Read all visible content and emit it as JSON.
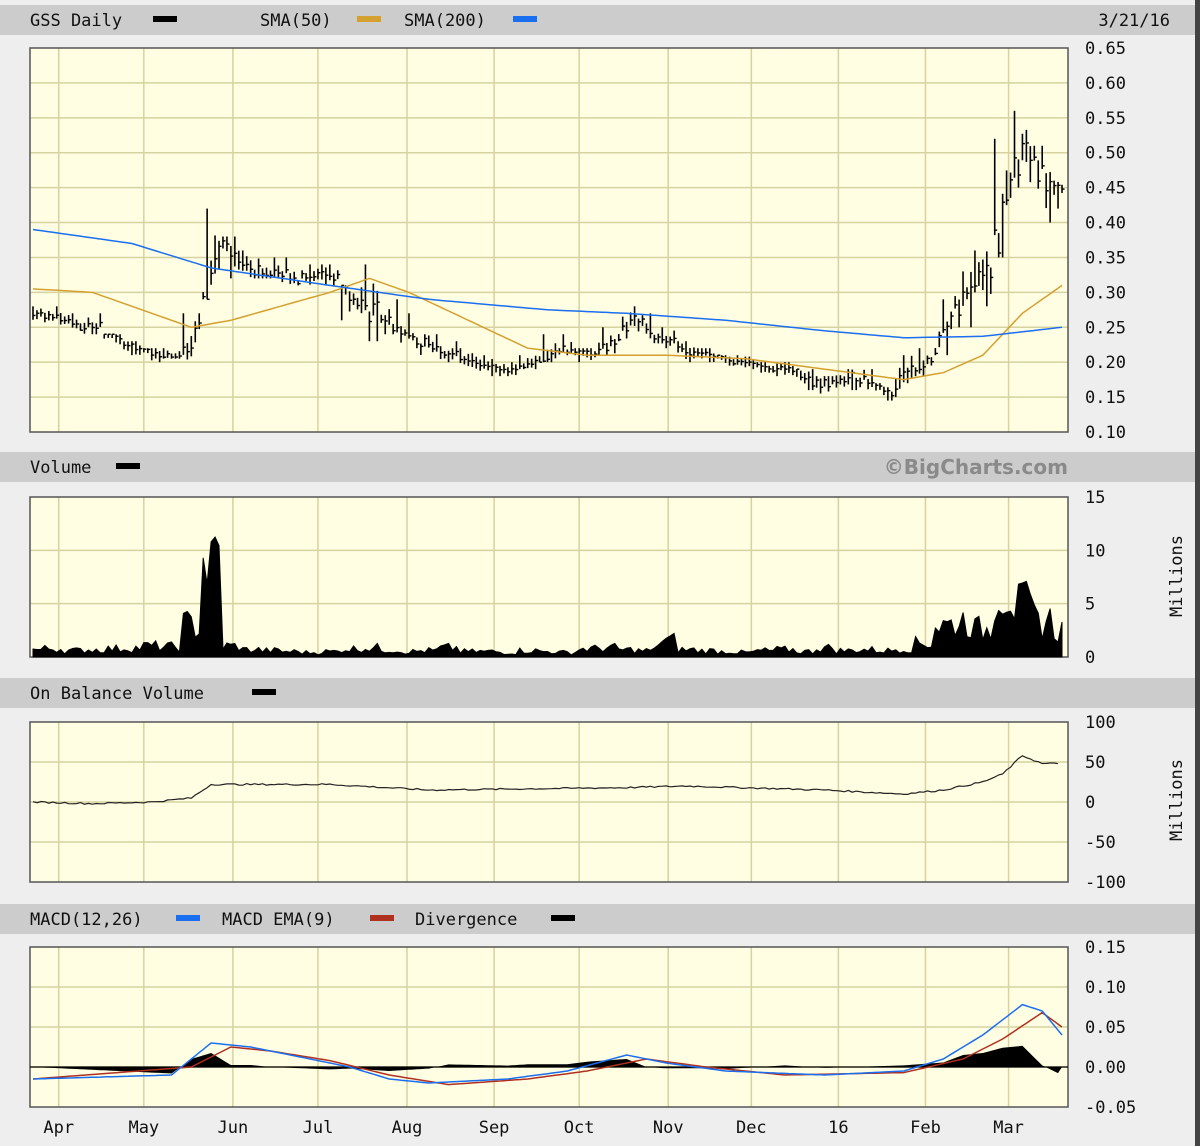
{
  "header": {
    "title": "GSS Daily",
    "sma50": "SMA(50)",
    "sma200": "SMA(200)",
    "date": "3/21/16",
    "volume": "Volume",
    "watermark": "©BigCharts.com",
    "obv": "On Balance Volume",
    "macd": "MACD(12,26)",
    "macd_ema": "MACD EMA(9)",
    "divergence": "Divergence"
  },
  "colors": {
    "price": "#000000",
    "sma50": "#d4a030",
    "sma200": "#1a6ff0",
    "macd": "#1a6ff0",
    "signal": "#b03020",
    "divergence": "#000000",
    "plot_bg": "#fffde2",
    "grid": "#d6d3a0"
  },
  "chart_data": [
    {
      "type": "ohlc",
      "title": "GSS Daily",
      "x_unit": "week index (0 = week of 3/23/15, 52 = week of 3/21/16)",
      "ylim": [
        0.1,
        0.65
      ],
      "yticks": [
        "0.65",
        "0.60",
        "0.55",
        "0.50",
        "0.45",
        "0.40",
        "0.35",
        "0.30",
        "0.25",
        "0.20",
        "0.15",
        "0.10"
      ],
      "weekly": {
        "high": [
          0.28,
          0.28,
          0.27,
          0.27,
          0.24,
          0.23,
          0.22,
          0.22,
          0.27,
          0.42,
          0.38,
          0.36,
          0.35,
          0.35,
          0.34,
          0.34,
          0.31,
          0.34,
          0.29,
          0.27,
          0.24,
          0.23,
          0.22,
          0.21,
          0.2,
          0.21,
          0.24,
          0.24,
          0.22,
          0.25,
          0.28,
          0.27,
          0.25,
          0.23,
          0.22,
          0.21,
          0.21,
          0.2,
          0.2,
          0.19,
          0.18,
          0.19,
          0.19,
          0.17,
          0.21,
          0.22,
          0.29,
          0.33,
          0.36,
          0.52,
          0.56,
          0.51,
          0.46
        ],
        "low": [
          0.26,
          0.25,
          0.245,
          0.24,
          0.22,
          0.21,
          0.2,
          0.205,
          0.2,
          0.29,
          0.32,
          0.32,
          0.32,
          0.31,
          0.31,
          0.31,
          0.26,
          0.23,
          0.24,
          0.22,
          0.2,
          0.2,
          0.19,
          0.18,
          0.18,
          0.19,
          0.2,
          0.21,
          0.2,
          0.21,
          0.23,
          0.22,
          0.22,
          0.2,
          0.2,
          0.195,
          0.19,
          0.185,
          0.18,
          0.16,
          0.14,
          0.16,
          0.16,
          0.145,
          0.15,
          0.18,
          0.21,
          0.25,
          0.28,
          0.35,
          0.45,
          0.4,
          0.42
        ],
        "close": [
          0.27,
          0.26,
          0.25,
          0.255,
          0.23,
          0.22,
          0.21,
          0.21,
          0.25,
          0.37,
          0.34,
          0.33,
          0.33,
          0.32,
          0.33,
          0.32,
          0.28,
          0.27,
          0.25,
          0.23,
          0.22,
          0.21,
          0.2,
          0.19,
          0.19,
          0.2,
          0.22,
          0.22,
          0.21,
          0.23,
          0.26,
          0.24,
          0.23,
          0.21,
          0.21,
          0.2,
          0.2,
          0.19,
          0.19,
          0.17,
          0.17,
          0.18,
          0.17,
          0.155,
          0.19,
          0.2,
          0.26,
          0.31,
          0.33,
          0.48,
          0.5,
          0.45,
          0.44
        ]
      },
      "sma50": [
        [
          0,
          0.305
        ],
        [
          3,
          0.3
        ],
        [
          6,
          0.27
        ],
        [
          8,
          0.25
        ],
        [
          10,
          0.26
        ],
        [
          15,
          0.3
        ],
        [
          17,
          0.32
        ],
        [
          19,
          0.3
        ],
        [
          22,
          0.26
        ],
        [
          25,
          0.22
        ],
        [
          28,
          0.21
        ],
        [
          32,
          0.21
        ],
        [
          36,
          0.205
        ],
        [
          40,
          0.19
        ],
        [
          44,
          0.175
        ],
        [
          46,
          0.185
        ],
        [
          48,
          0.21
        ],
        [
          50,
          0.27
        ],
        [
          52,
          0.31
        ]
      ],
      "sma200": [
        [
          0,
          0.39
        ],
        [
          5,
          0.37
        ],
        [
          9,
          0.335
        ],
        [
          15,
          0.31
        ],
        [
          20,
          0.29
        ],
        [
          26,
          0.275
        ],
        [
          30,
          0.27
        ],
        [
          35,
          0.26
        ],
        [
          40,
          0.245
        ],
        [
          44,
          0.235
        ],
        [
          48,
          0.237
        ],
        [
          52,
          0.25
        ]
      ]
    },
    {
      "type": "area",
      "title": "Volume",
      "ylabel": "Millions",
      "ylim": [
        0,
        15
      ],
      "yticks": [
        "15",
        "10",
        "5",
        "0"
      ],
      "weekly": [
        0.8,
        0.9,
        0.7,
        0.8,
        0.9,
        1.0,
        1.2,
        1.1,
        3.5,
        10.8,
        1.2,
        0.8,
        0.7,
        0.6,
        0.5,
        0.6,
        0.9,
        1.0,
        0.8,
        0.6,
        0.7,
        1.0,
        0.6,
        0.6,
        0.5,
        0.7,
        0.6,
        0.5,
        0.9,
        1.0,
        0.8,
        0.7,
        1.8,
        0.8,
        0.7,
        0.6,
        0.5,
        0.7,
        0.8,
        0.6,
        1.0,
        0.7,
        0.8,
        0.7,
        0.9,
        1.5,
        3.5,
        4.0,
        3.0,
        7.5,
        5.5,
        4.0,
        3.0
      ]
    },
    {
      "type": "line",
      "title": "On Balance Volume",
      "ylabel": "Millions",
      "ylim": [
        -100,
        100
      ],
      "yticks": [
        "100",
        "50",
        "0",
        "-50",
        "-100"
      ],
      "keypoints": [
        [
          0,
          0
        ],
        [
          3,
          -2
        ],
        [
          6,
          0
        ],
        [
          8,
          5
        ],
        [
          9,
          22
        ],
        [
          15,
          22
        ],
        [
          20,
          15
        ],
        [
          30,
          18
        ],
        [
          33,
          20
        ],
        [
          40,
          15
        ],
        [
          44,
          10
        ],
        [
          46,
          15
        ],
        [
          48,
          25
        ],
        [
          49,
          35
        ],
        [
          50,
          58
        ],
        [
          51,
          48
        ],
        [
          52,
          48
        ]
      ]
    },
    {
      "type": "line",
      "title": "MACD(12,26)",
      "ylim": [
        -0.05,
        0.15
      ],
      "yticks": [
        "0.15",
        "0.10",
        "0.05",
        "0.00",
        "-0.05"
      ],
      "macd": [
        [
          0,
          -0.015
        ],
        [
          7,
          -0.01
        ],
        [
          8,
          0.01
        ],
        [
          9,
          0.03
        ],
        [
          11,
          0.025
        ],
        [
          14,
          0.01
        ],
        [
          16,
          0
        ],
        [
          18,
          -0.015
        ],
        [
          20,
          -0.02
        ],
        [
          24,
          -0.015
        ],
        [
          27,
          -0.005
        ],
        [
          30,
          0.015
        ],
        [
          32,
          0.005
        ],
        [
          35,
          -0.005
        ],
        [
          40,
          -0.01
        ],
        [
          44,
          -0.005
        ],
        [
          46,
          0.01
        ],
        [
          48,
          0.04
        ],
        [
          50,
          0.078
        ],
        [
          51,
          0.07
        ],
        [
          52,
          0.04
        ]
      ],
      "signal": [
        [
          0,
          -0.015
        ],
        [
          8,
          0
        ],
        [
          10,
          0.025
        ],
        [
          12,
          0.02
        ],
        [
          15,
          0.008
        ],
        [
          18,
          -0.01
        ],
        [
          21,
          -0.022
        ],
        [
          25,
          -0.015
        ],
        [
          28,
          -0.005
        ],
        [
          31,
          0.01
        ],
        [
          34,
          0
        ],
        [
          38,
          -0.01
        ],
        [
          44,
          -0.007
        ],
        [
          47,
          0.01
        ],
        [
          49,
          0.035
        ],
        [
          51,
          0.068
        ],
        [
          52,
          0.05
        ]
      ]
    },
    {
      "type": "x-axis",
      "months": [
        {
          "label": "Apr",
          "week": 1.3
        },
        {
          "label": "May",
          "week": 5.6
        },
        {
          "label": "Jun",
          "week": 10.1
        },
        {
          "label": "Jul",
          "week": 14.4
        },
        {
          "label": "Aug",
          "week": 18.9
        },
        {
          "label": "Sep",
          "week": 23.3
        },
        {
          "label": "Oct",
          "week": 27.6
        },
        {
          "label": "Nov",
          "week": 32.1
        },
        {
          "label": "Dec",
          "week": 36.3
        },
        {
          "label": "16",
          "week": 40.7
        },
        {
          "label": "Feb",
          "week": 45.1
        },
        {
          "label": "Mar",
          "week": 49.3
        }
      ]
    }
  ]
}
